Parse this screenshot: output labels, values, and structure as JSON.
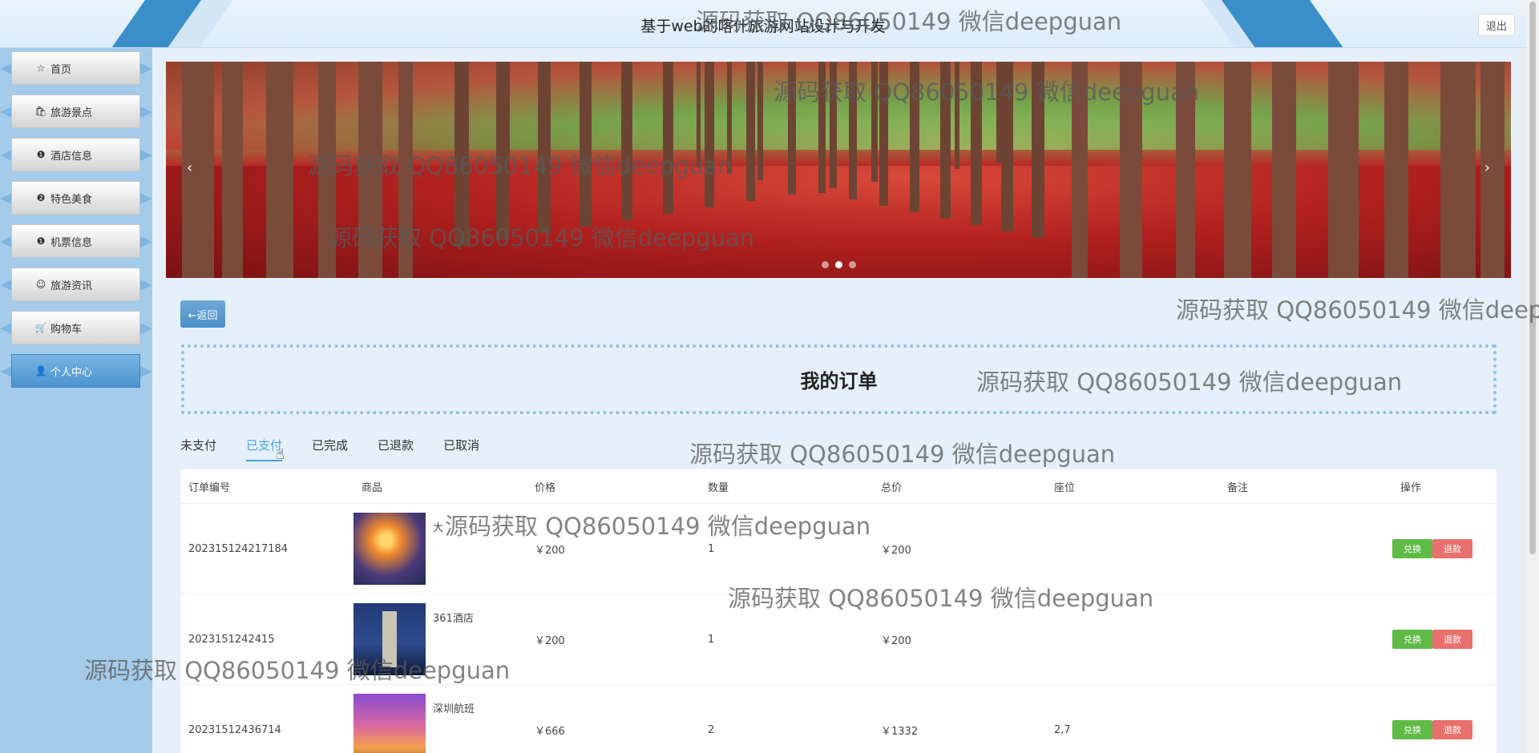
{
  "header": {
    "title": "基于web的喀什旅游网站设计与开发",
    "logout_label": "退出"
  },
  "sidebar": {
    "items": [
      {
        "label": "首页",
        "icon": "star-icon",
        "glyph": "☆"
      },
      {
        "label": "旅游景点",
        "icon": "bag-icon",
        "glyph": "🛍"
      },
      {
        "label": "酒店信息",
        "icon": "info-icon",
        "glyph": "❶"
      },
      {
        "label": "特色美食",
        "icon": "question-icon",
        "glyph": "❷"
      },
      {
        "label": "机票信息",
        "icon": "info-circle-icon",
        "glyph": "❶"
      },
      {
        "label": "旅游资讯",
        "icon": "smile-icon",
        "glyph": "☺"
      },
      {
        "label": "购物车",
        "icon": "cart-icon",
        "glyph": "🛒"
      },
      {
        "label": "个人中心",
        "icon": "user-icon",
        "glyph": "👤"
      }
    ],
    "active_index": 7
  },
  "banner": {
    "prev": "‹",
    "next": "›",
    "dots": 3,
    "active_dot": 1
  },
  "back_label": "←返回",
  "page_title": "我的订单",
  "tabs": [
    "未支付",
    "已支付",
    "已完成",
    "已退款",
    "已取消"
  ],
  "active_tab": 1,
  "table": {
    "headers": [
      "订单编号",
      "商品",
      "价格",
      "数量",
      "总价",
      "座位",
      "备注",
      "操作"
    ],
    "rows": [
      {
        "order_no": "202315124217184",
        "product": "大",
        "thumb": "t1",
        "price": "￥200",
        "qty": "1",
        "total": "￥200",
        "seat": "",
        "note": ""
      },
      {
        "order_no": "2023151242415",
        "product": "361酒店",
        "thumb": "t2",
        "price": "￥200",
        "qty": "1",
        "total": "￥200",
        "seat": "",
        "note": ""
      },
      {
        "order_no": "20231512436714",
        "product": "深圳航班",
        "thumb": "t3",
        "price": "￥666",
        "qty": "2",
        "total": "￥1332",
        "seat": "2,7",
        "note": ""
      }
    ],
    "action_redeem": "兑换",
    "action_refund": "退款"
  },
  "watermark": "源码获取 QQ86050149 微信deepguan",
  "colors": {
    "sidebar": "#a4cbe9",
    "accent": "#4aa3d8",
    "green": "#5fbb46",
    "red": "#e8706d"
  }
}
